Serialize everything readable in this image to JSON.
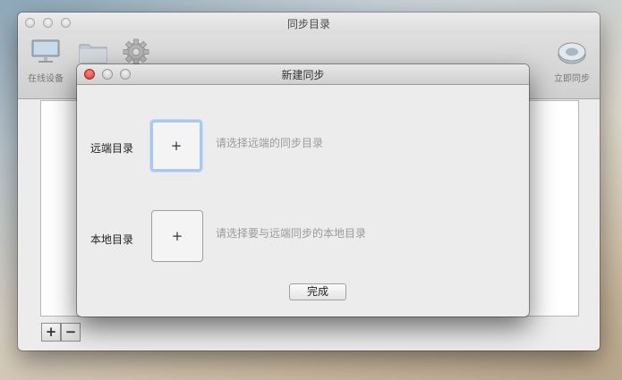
{
  "main_window": {
    "title": "同步目录",
    "toolbar": {
      "online_devices_label": "在线设备",
      "sync_now_label": "立即同步"
    },
    "add_symbol": "+",
    "remove_symbol": "−"
  },
  "dialog": {
    "title": "新建同步",
    "remote": {
      "label": "远端目录",
      "picker_symbol": "+",
      "hint": "请选择远端的同步目录"
    },
    "local": {
      "label": "本地目录",
      "picker_symbol": "+",
      "hint": "请选择要与远端同步的本地目录"
    },
    "done_label": "完成"
  },
  "icons": {
    "monitor": "monitor-icon",
    "folder": "folder-icon",
    "gear": "gear-icon",
    "sync": "sync-disc-icon"
  },
  "colors": {
    "close_red": "#e0443e",
    "focus_ring": "#a8c8f0"
  }
}
